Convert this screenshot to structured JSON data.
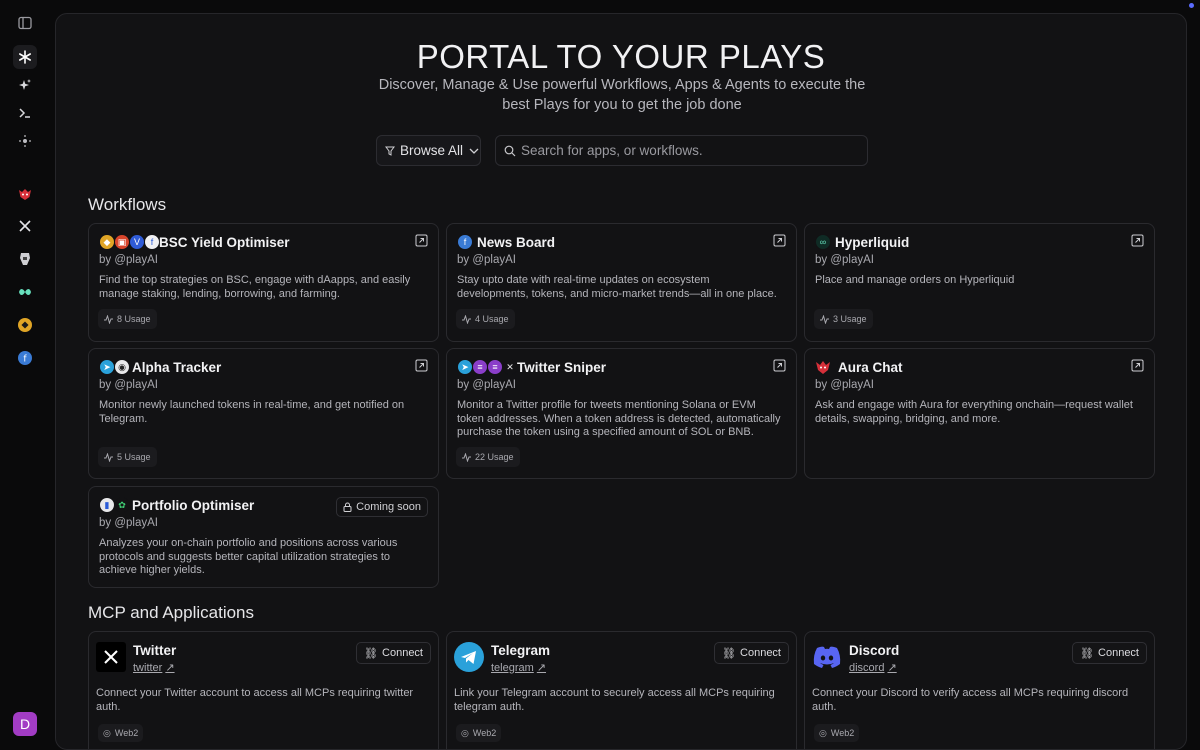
{
  "hero": {
    "title": "PORTAL TO YOUR PLAYS",
    "subtitle": "Discover, Manage & Use powerful Workflows, Apps & Agents to execute the best Plays for you to get the job done"
  },
  "filters": {
    "browse_label": "Browse All",
    "search_placeholder": "Search for apps, or workflows."
  },
  "sections": {
    "workflows": "Workflows",
    "mcp": "MCP and Applications"
  },
  "workflows": [
    {
      "title": "BSC Yield Optimiser",
      "by": "by @playAI",
      "desc": "Find the top strategies on BSC, engage with dAapps, and easily manage staking, lending, borrowing, and farming.",
      "usage": "8 Usage"
    },
    {
      "title": "News Board",
      "by": "by @playAI",
      "desc": "Stay upto date with real-time updates on ecosystem developments, tokens, and micro-market trends—all in one place.",
      "usage": "4 Usage"
    },
    {
      "title": "Hyperliquid",
      "by": "by @playAI",
      "desc": "Place and manage orders on Hyperliquid",
      "usage": "3 Usage"
    },
    {
      "title": "Alpha Tracker",
      "by": "by @playAI",
      "desc": "Monitor newly launched tokens in real-time, and get notified on Telegram.",
      "usage": "5 Usage"
    },
    {
      "title": "Twitter Sniper",
      "by": "by @playAI",
      "desc": "Monitor a Twitter profile for tweets mentioning Solana or EVM token addresses. When a token address is detected, automatically purchase the token using a specified amount of SOL or BNB.",
      "usage": "22 Usage"
    },
    {
      "title": "Aura Chat",
      "by": "by @playAI",
      "desc": "Ask and engage with Aura for everything onchain—request wallet details, swapping, bridging, and more."
    },
    {
      "title": "Portfolio Optimiser",
      "by": "by @playAI",
      "desc": "Analyzes your on-chain portfolio and positions across various protocols and suggests better capital utilization strategies to achieve higher yields.",
      "badge": "Coming soon"
    }
  ],
  "mcp": [
    {
      "title": "Twitter",
      "link": "twitter",
      "connect": "Connect",
      "desc": "Connect your Twitter account to access all MCPs requiring twitter auth.",
      "tag": "Web2"
    },
    {
      "title": "Telegram",
      "link": "telegram",
      "connect": "Connect",
      "desc": "Link your Telegram account to securely access all MCPs requiring telegram auth.",
      "tag": "Web2"
    },
    {
      "title": "Discord",
      "link": "discord",
      "connect": "Connect",
      "desc": "Connect your Discord to verify access all MCPs requiring discord auth.",
      "tag": "Web2"
    }
  ],
  "user": {
    "initial": "D"
  },
  "colors": {
    "bg": "#0a0a0b",
    "panel": "#121214",
    "border": "#2a2a2e",
    "avatar": "#a23cc4",
    "telegram": "#2aa1da",
    "discord": "#5865f2"
  }
}
